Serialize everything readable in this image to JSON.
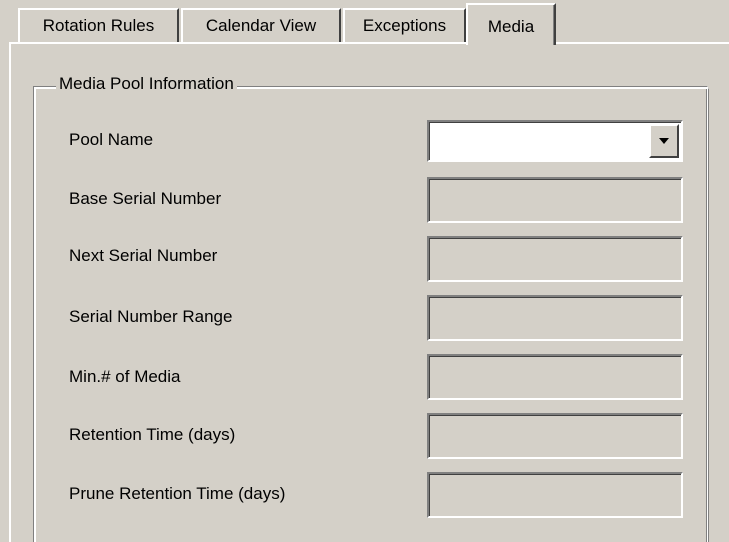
{
  "tabs": [
    {
      "label": "Rotation Rules",
      "active": false
    },
    {
      "label": "Calendar View",
      "active": false
    },
    {
      "label": "Exceptions",
      "active": false
    },
    {
      "label": "Media",
      "active": true
    }
  ],
  "group": {
    "title": "Media Pool Information"
  },
  "fields": {
    "pool_name": {
      "label": "Pool Name",
      "value": "",
      "enabled": true
    },
    "base_serial": {
      "label": "Base Serial Number",
      "value": "",
      "enabled": false
    },
    "next_serial": {
      "label": "Next Serial Number",
      "value": "",
      "enabled": false
    },
    "serial_range": {
      "label": "Serial Number Range",
      "value": "",
      "enabled": false
    },
    "min_media": {
      "label": "Min.# of Media",
      "value": "",
      "enabled": false
    },
    "retention": {
      "label": "Retention Time (days)",
      "value": "",
      "enabled": false
    },
    "prune_retention": {
      "label": "Prune Retention Time (days)",
      "value": "",
      "enabled": false
    }
  },
  "icons": {
    "combo_arrow": "dropdown-arrow-icon"
  },
  "colors": {
    "face": "#d4d0c8",
    "highlight": "#ffffff",
    "shadow": "#808080",
    "dark_shadow": "#404040",
    "window": "#ffffff"
  }
}
